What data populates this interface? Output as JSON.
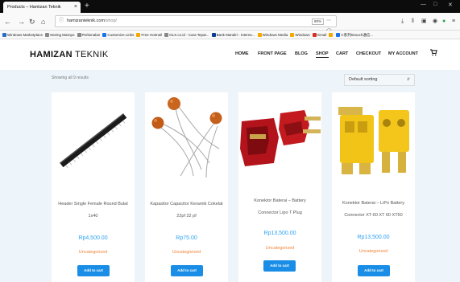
{
  "browser": {
    "tab_title": "Products – Hamizan Teknik",
    "tab_close": "×",
    "new_tab": "+",
    "url_domain": "hamizanteknik.com",
    "url_path": "/shop/",
    "zoom": "80%",
    "bookmarks": [
      {
        "label": "Windows Marketplace",
        "color": "#2b6cc4"
      },
      {
        "label": "Seeing Marnpo",
        "color": "#888888"
      },
      {
        "label": "Perkenalan",
        "color": "#888888"
      },
      {
        "label": "Customize Links",
        "color": "#1a73e8"
      },
      {
        "label": "Free Hotmail",
        "color": "#f2a900"
      },
      {
        "label": "OLX.co.id - Cara Tepat...",
        "color": "#888888"
      },
      {
        "label": "Bank Mandiri - Interne...",
        "color": "#0b3d91"
      },
      {
        "label": "Windows Media",
        "color": "#f2a900"
      },
      {
        "label": "Windows",
        "color": "#f2a900"
      },
      {
        "label": "Gmail",
        "color": "#d93025"
      },
      {
        "label": "",
        "color": "#f2a900"
      },
      {
        "label": "C系列Intouch通信...",
        "color": "#1a73e8"
      }
    ]
  },
  "site": {
    "logo_bold": "HAMIZAN",
    "logo_light": "TEKNIK",
    "menu": [
      "HOME",
      "FRONT PAGE",
      "BLOG",
      "SHOP",
      "CART",
      "CHECKOUT",
      "MY ACCOUNT"
    ],
    "active_menu": "SHOP"
  },
  "shop": {
    "results_text": "Showing all 9 results",
    "sort_value": "Default sorting",
    "add_to_cart": "Add to cart",
    "products": [
      {
        "name_line1": "Header Single Female Round Bulat",
        "name_line2": "1x40",
        "price": "Rp4,500.00",
        "category": "Uncategorized"
      },
      {
        "name_line1": "Kapasitor Capacitor Keramik Cokelat",
        "name_line2": "22pf 22 pf",
        "price": "Rp75.00",
        "category": "Uncategorized"
      },
      {
        "name_line1": "Konektor Baterai – Battery",
        "name_line2": "Connector Lipo T Plug",
        "price": "Rp13,500.00",
        "category": "Uncategorized"
      },
      {
        "name_line1": "Konektor Baterai – LiPo Battery",
        "name_line2": "Connector XT-60 XT 60 XT60",
        "price": "Rp13,500.00",
        "category": "Uncategorized"
      }
    ]
  },
  "colors": {
    "accent_blue": "#2ea3f2",
    "button_blue": "#1a8ee6",
    "category_orange": "#f0833a",
    "shop_background": "#eef5fa"
  }
}
